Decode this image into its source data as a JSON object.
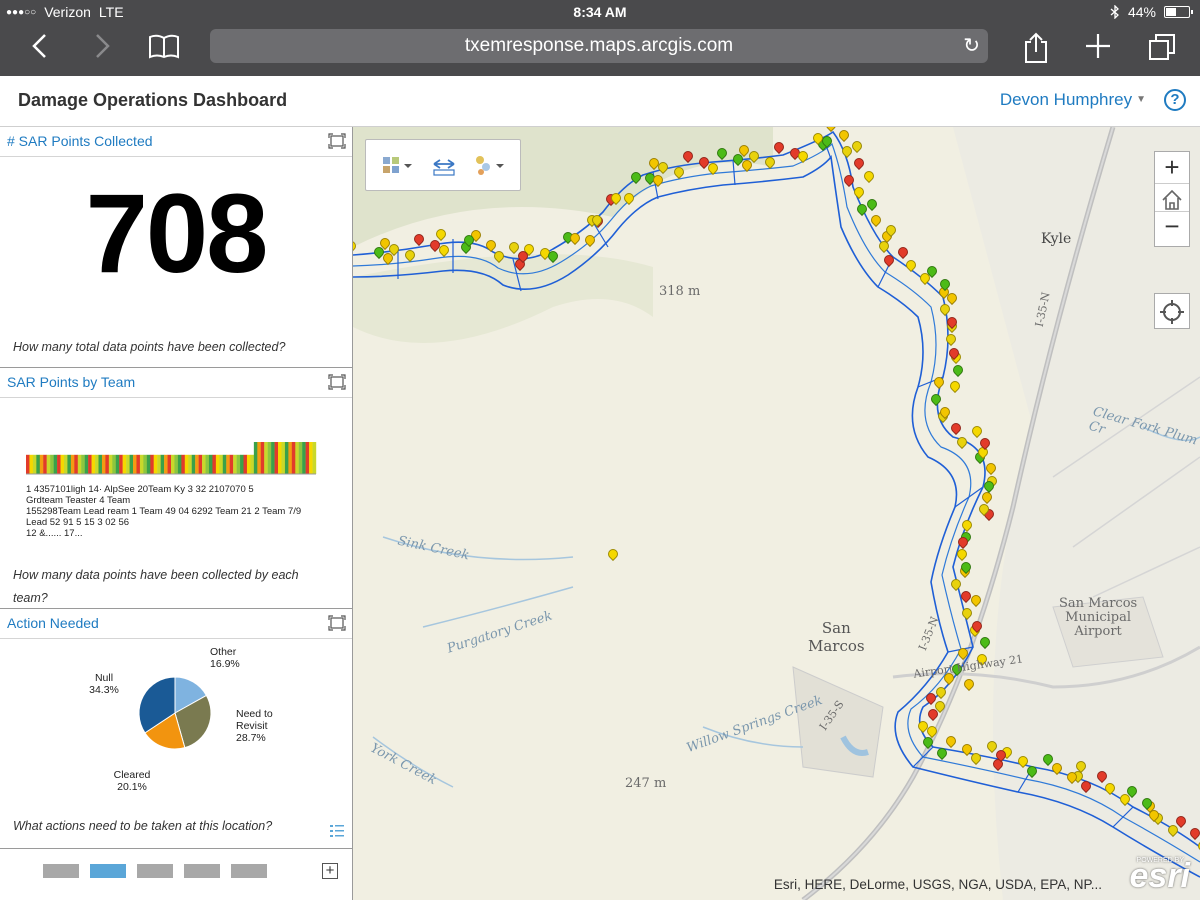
{
  "status_bar": {
    "signal": "●●●○○",
    "carrier": "Verizon",
    "network": "LTE",
    "time": "8:34 AM",
    "bluetooth_icon": "bluetooth-icon",
    "battery_percent": "44%",
    "battery_level": 0.44
  },
  "browser": {
    "url": "txemresponse.maps.arcgis.com",
    "icons": [
      "back-icon",
      "forward-icon",
      "bookmarks-icon",
      "reload-icon",
      "share-icon",
      "new-tab-icon",
      "tabs-icon"
    ]
  },
  "header": {
    "title": "Damage Operations Dashboard",
    "user_name": "Devon Humphrey",
    "help_label": "?"
  },
  "panels": {
    "sar_points": {
      "title": "# SAR Points Collected",
      "value": "708",
      "description": "How many total data points have been collected?"
    },
    "by_team": {
      "title": "SAR Points by Team",
      "description": "How many data points have been collected by each team?"
    },
    "action_needed": {
      "title": "Action Needed",
      "description": "What actions need to be taken at this location?"
    }
  },
  "pager": {
    "pages": 5,
    "active_index": 1
  },
  "map": {
    "labels": {
      "kyle": "Kyle",
      "san_marcos": "San\nMarcos",
      "airport": "San Marcos\nMunicipal\nAirport",
      "sink_creek": "Sink Creek",
      "purgatory_creek": "Purgatory Creek",
      "york_creek": "York Creek",
      "willow_springs": "Willow Springs Creek",
      "clear_fork": "Clear Fork Plum Cr",
      "i35n": "I-35-N",
      "i35s": "I-35-S",
      "elev_318": "318 m",
      "elev_247": "247 m",
      "hwy21": "Airport Highway 21"
    },
    "attribution": "Esri, HERE, DeLorme, USGS, NGA, USDA, EPA, NP...",
    "logo_caption": "POWERED BY",
    "logo": "esri",
    "zoom_in": "+",
    "zoom_out": "−"
  },
  "chart_data": [
    {
      "type": "bar",
      "title": "SAR Points by Team",
      "series_colors": [
        "#e23b2a",
        "#f5d800",
        "#c9d82b",
        "#8dc63f",
        "#3aa14a",
        "#f39c12"
      ],
      "note": "bars visible: many small equal-height bars then a step up to taller bars",
      "values": [
        6,
        6,
        6,
        6,
        6,
        6,
        6,
        6,
        6,
        6,
        6,
        6,
        6,
        6,
        6,
        6,
        6,
        6,
        6,
        6,
        6,
        6,
        6,
        6,
        6,
        6,
        6,
        6,
        6,
        6,
        6,
        6,
        6,
        6,
        6,
        6,
        6,
        6,
        6,
        6,
        6,
        6,
        6,
        6,
        6,
        6,
        6,
        6,
        6,
        6,
        6,
        6,
        6,
        6,
        6,
        6,
        6,
        6,
        6,
        6,
        6,
        6,
        6,
        6,
        6,
        6,
        10,
        10,
        10,
        10,
        10,
        10,
        10,
        10,
        10,
        10,
        10,
        10,
        10,
        10,
        10,
        10,
        10,
        10
      ],
      "tick_labels_row1": "1 4357101ligh  14·  AlpSee 20Team Ky 3 32   2107070 5",
      "tick_labels_row2": "Grdteam Teaster          4                   Team",
      "tick_labels_row3": "155298Team Lead ream 1 Team 49  04 6292 Team  21   2 Team  7/9",
      "tick_labels_row4": "Lead 52    91                       5 15 3  02    56",
      "tick_labels_row5": "12  &......  17...",
      "ylim": [
        0,
        10
      ]
    },
    {
      "type": "pie",
      "title": "Action Needed",
      "slices": [
        {
          "label": "Other",
          "value": 16.9,
          "display": "16.9%",
          "color": "#7fb3e0"
        },
        {
          "label": "Need to\nRevisit",
          "value": 28.7,
          "display": "28.7%",
          "color": "#7a7a50"
        },
        {
          "label": "Cleared",
          "value": 20.1,
          "display": "20.1%",
          "color": "#f2940f"
        },
        {
          "label": "Null",
          "value": 34.3,
          "display": "34.3%",
          "color": "#1a5a96"
        }
      ]
    }
  ]
}
